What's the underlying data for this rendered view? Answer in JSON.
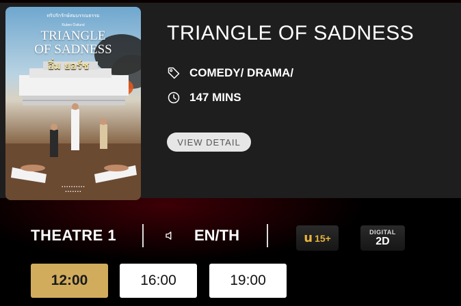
{
  "movie": {
    "title": "TRIANGLE OF SADNESS",
    "genre": "COMEDY/ DRAMA/",
    "duration": "147 MINS",
    "view_detail_label": "VIEW DETAIL",
    "poster": {
      "title_line1": "TRIANGLE",
      "title_line2": "OF SADNESS",
      "thai_title": "อิ่ม ยอร์ช"
    }
  },
  "session": {
    "theatre": "THEATRE 1",
    "language": "EN/TH",
    "rating": {
      "letter": "u",
      "age": "15+"
    },
    "format": {
      "top": "DIGITAL",
      "bottom": "2D"
    }
  },
  "showtimes": [
    {
      "time": "12:00",
      "selected": true
    },
    {
      "time": "16:00",
      "selected": false
    },
    {
      "time": "19:00",
      "selected": false
    }
  ],
  "colors": {
    "accent_gold": "#d1ac5d",
    "rating_gold": "#e7b53b",
    "card_bg": "#1e1e1e",
    "page_bg": "#000000"
  },
  "icons": {
    "genre": "tag-icon",
    "duration": "clock-icon",
    "language": "speaker-icon"
  }
}
